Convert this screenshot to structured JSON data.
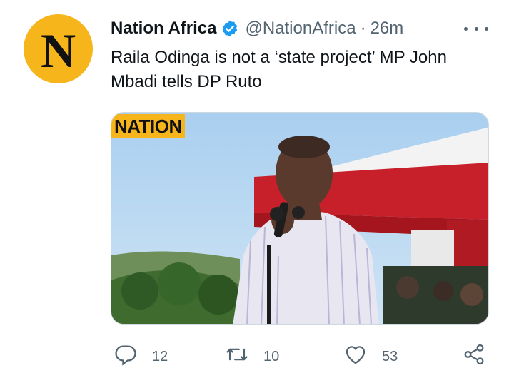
{
  "tweet": {
    "avatar_letter": "N",
    "display_name": "Nation Africa",
    "handle": "@NationAfrica",
    "separator": "·",
    "time": "26m",
    "text": "Raila Odinga is not a ‘state project’ MP John Mbadi tells DP Ruto",
    "media": {
      "overlay_logo": "NATION",
      "colors": {
        "logo_bg": "#f7b51c",
        "sky": "#bcd8ef",
        "tent_red": "#c8202a"
      }
    },
    "actions": {
      "reply_count": "12",
      "retweet_count": "10",
      "like_count": "53"
    },
    "icons": [
      "verified-badge-icon",
      "more-icon",
      "reply-icon",
      "retweet-icon",
      "like-icon",
      "share-icon"
    ]
  },
  "colors": {
    "accent": "#1d9bf0",
    "text_secondary": "#536471",
    "avatar_bg": "#f7b51c"
  }
}
